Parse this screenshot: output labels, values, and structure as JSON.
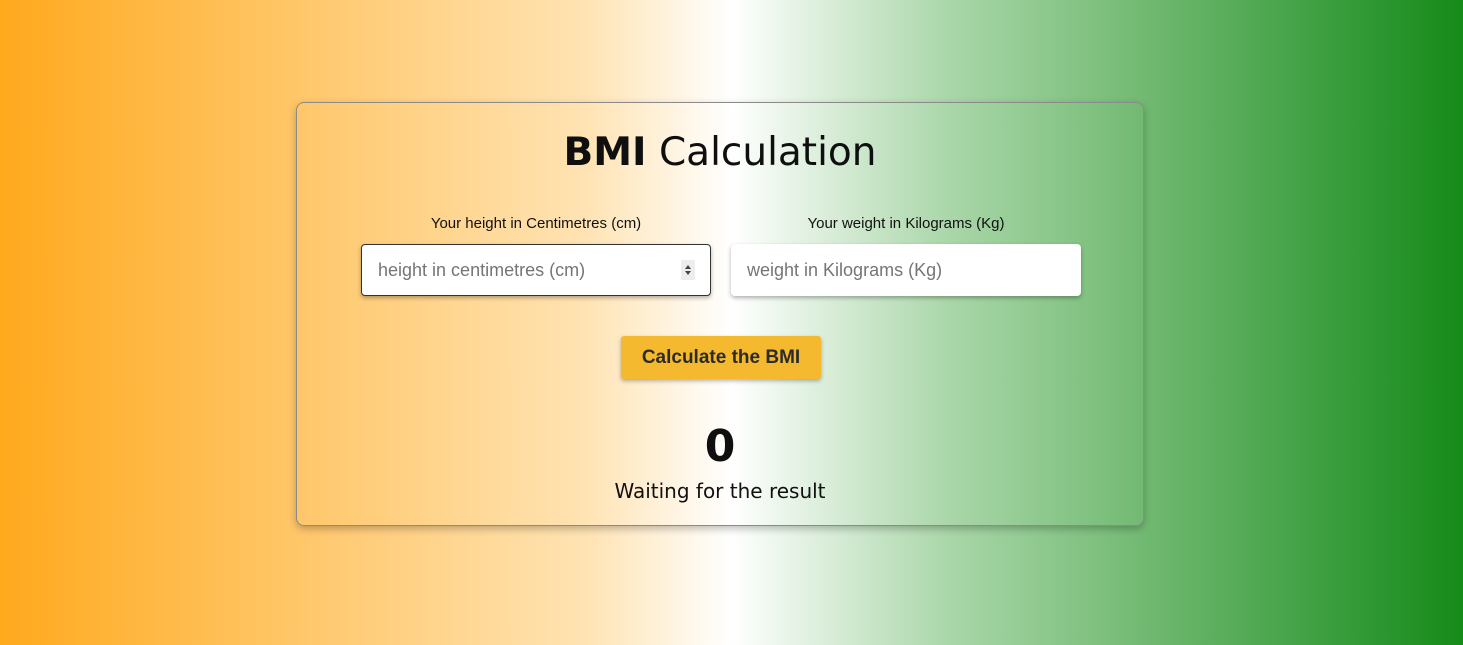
{
  "title": {
    "bold": "BMI",
    "light": "Calculation"
  },
  "height": {
    "label": "Your height in Centimetres (cm)",
    "placeholder": "height in centimetres (cm)",
    "value": ""
  },
  "weight": {
    "label": "Your weight in Kilograms (Kg)",
    "placeholder": "weight in Kilograms (Kg)",
    "value": ""
  },
  "button": {
    "label": "Calculate the BMI"
  },
  "result": {
    "value": "0",
    "message": "Waiting for the result"
  },
  "colors": {
    "gradient_left": "#ffa91d",
    "gradient_middle": "#ffffff",
    "gradient_right": "#158a19",
    "button": "#f4b92e"
  }
}
